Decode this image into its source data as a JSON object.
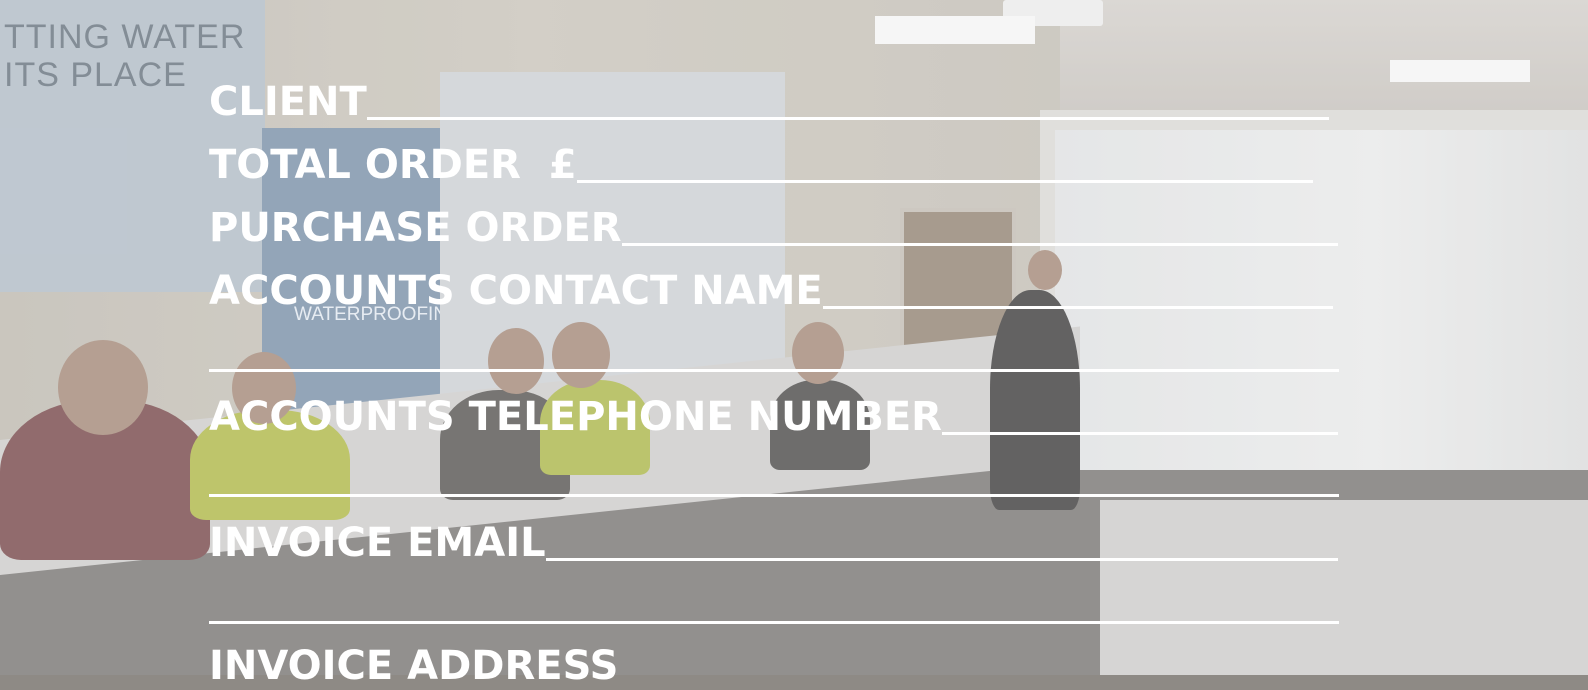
{
  "background": {
    "poster_left_text": "TTING WATER\nITS PLACE",
    "poster_middle_text": "WATERPROOFING"
  },
  "form": {
    "client_label": "CLIENT",
    "total_order_label": "TOTAL ORDER  £",
    "purchase_order_label": "PURCHASE ORDER",
    "accounts_contact_name_label": "ACCOUNTS CONTACT NAME",
    "accounts_telephone_number_label": "ACCOUNTS TELEPHONE NUMBER",
    "invoice_email_label": "INVOICE EMAIL",
    "invoice_address_label": "INVOICE ADDRESS"
  },
  "colors": {
    "text": "#ffffff",
    "overlay": "rgba(255,255,255,0.25)"
  }
}
